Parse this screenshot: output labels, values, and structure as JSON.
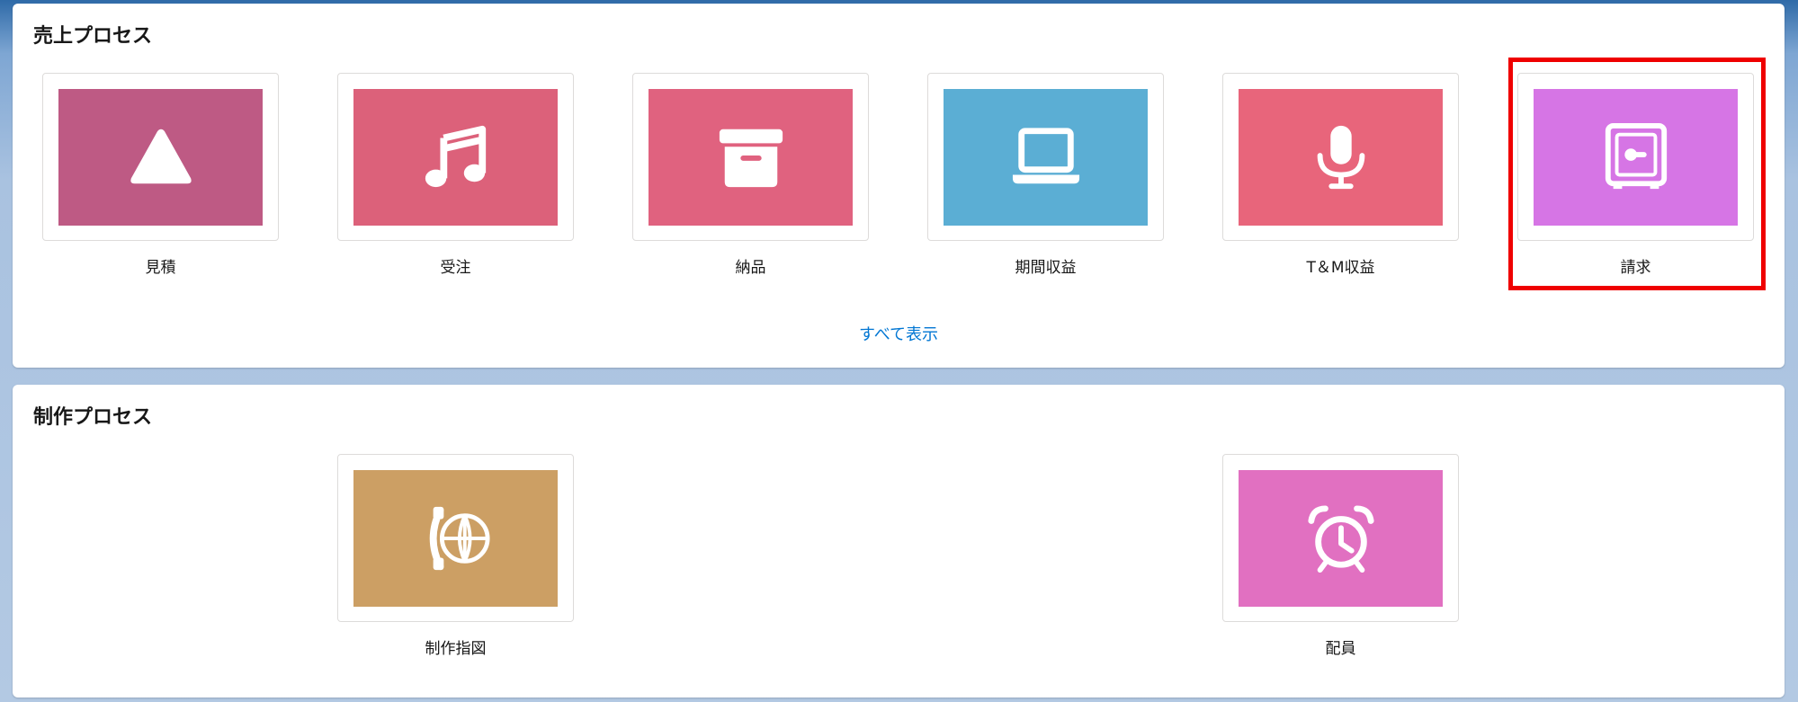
{
  "sales_section": {
    "title": "売上プロセス",
    "tiles": [
      {
        "label": "見積",
        "color": "#be5a84",
        "icon": "triangle-icon"
      },
      {
        "label": "受注",
        "color": "#dc617a",
        "icon": "music-note-icon"
      },
      {
        "label": "納品",
        "color": "#e0627f",
        "icon": "archive-box-icon"
      },
      {
        "label": "期間収益",
        "color": "#5baed4",
        "icon": "laptop-icon"
      },
      {
        "label": "T＆M収益",
        "color": "#e8657b",
        "icon": "microphone-icon"
      },
      {
        "label": "請求",
        "color": "#d675e5",
        "icon": "safe-icon"
      }
    ],
    "view_all": "すべて表示"
  },
  "production_section": {
    "title": "制作プロセス",
    "tiles": [
      {
        "label": "制作指図",
        "color": "#cc9f64",
        "icon": "phone-globe-icon"
      },
      {
        "label": "配員",
        "color": "#e170c1",
        "icon": "alarm-clock-icon"
      }
    ]
  },
  "highlight_color": "#ef0000"
}
